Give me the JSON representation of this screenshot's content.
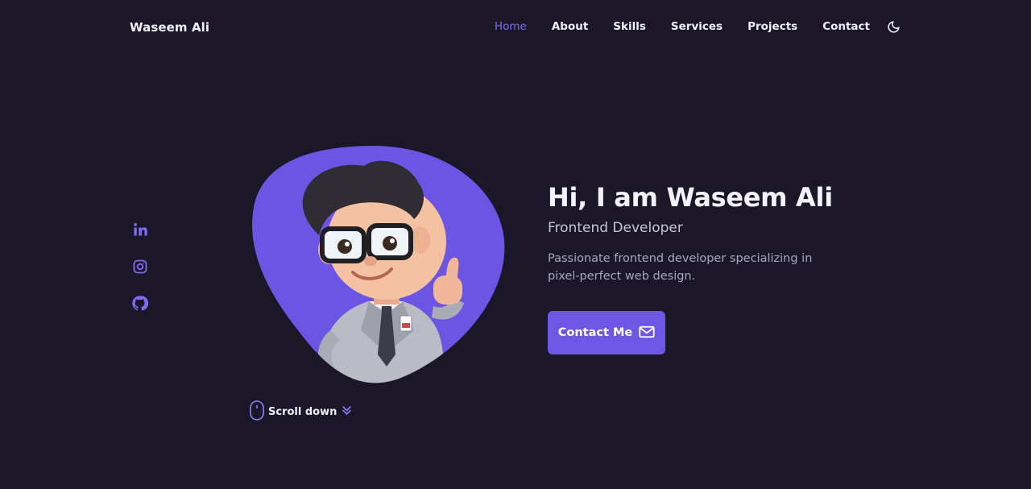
{
  "header": {
    "logo": "Waseem Ali",
    "nav": [
      {
        "label": "Home",
        "active": true
      },
      {
        "label": "About",
        "active": false
      },
      {
        "label": "Skills",
        "active": false
      },
      {
        "label": "Services",
        "active": false
      },
      {
        "label": "Projects",
        "active": false
      },
      {
        "label": "Contact",
        "active": false
      }
    ],
    "theme_icon": "moon-icon"
  },
  "socials": [
    {
      "icon": "linkedin-icon"
    },
    {
      "icon": "instagram-icon"
    },
    {
      "icon": "github-icon"
    }
  ],
  "hero": {
    "title": "Hi, I am Waseem Ali",
    "subtitle": "Frontend Developer",
    "description": "Passionate frontend developer specializing in pixel-perfect web design.",
    "cta_label": "Contact Me",
    "cta_icon": "mail-icon",
    "avatar_icon": "cartoon-avatar"
  },
  "scroll": {
    "label": "Scroll down",
    "mouse_icon": "mouse-icon",
    "arrow_icon": "chevrons-down-icon"
  },
  "colors": {
    "background": "#1b1728",
    "accent": "#6f57e6",
    "blob": "#6c55e3",
    "text": "#f1eff7",
    "muted": "#aaa5bf"
  }
}
